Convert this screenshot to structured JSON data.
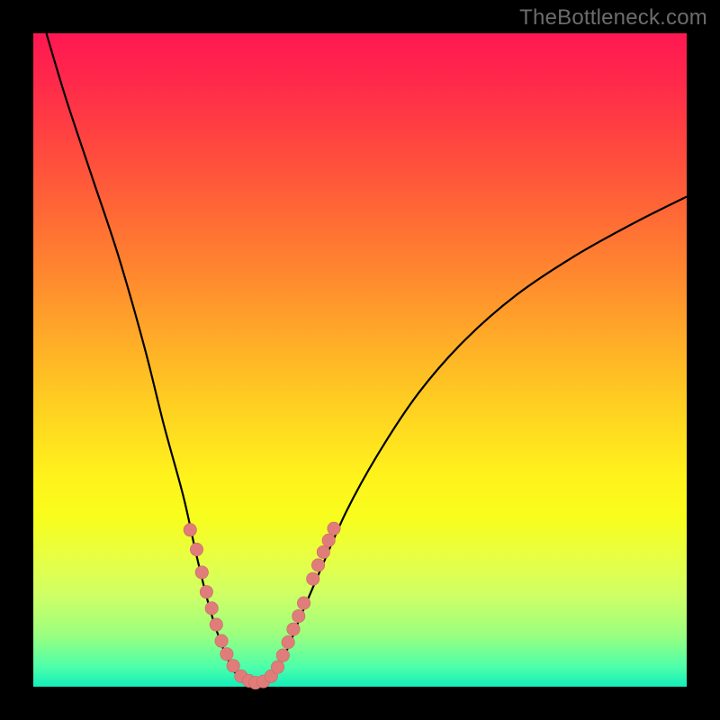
{
  "watermark": "TheBottleneck.com",
  "chart_data": {
    "type": "line",
    "title": "",
    "xlabel": "",
    "ylabel": "",
    "xlim": [
      0,
      100
    ],
    "ylim": [
      0,
      100
    ],
    "curve": {
      "name": "bottleneck-curve",
      "points": [
        {
          "x": 2,
          "y": 100
        },
        {
          "x": 5,
          "y": 90
        },
        {
          "x": 9,
          "y": 78
        },
        {
          "x": 13,
          "y": 66
        },
        {
          "x": 17,
          "y": 52
        },
        {
          "x": 20,
          "y": 40
        },
        {
          "x": 23,
          "y": 29
        },
        {
          "x": 25,
          "y": 20
        },
        {
          "x": 27,
          "y": 12
        },
        {
          "x": 29,
          "y": 6
        },
        {
          "x": 31,
          "y": 2
        },
        {
          "x": 33,
          "y": 0.3
        },
        {
          "x": 35,
          "y": 0.3
        },
        {
          "x": 37,
          "y": 2
        },
        {
          "x": 39,
          "y": 6
        },
        {
          "x": 41,
          "y": 11
        },
        {
          "x": 44,
          "y": 18
        },
        {
          "x": 48,
          "y": 27
        },
        {
          "x": 53,
          "y": 36
        },
        {
          "x": 59,
          "y": 45
        },
        {
          "x": 66,
          "y": 53
        },
        {
          "x": 74,
          "y": 60
        },
        {
          "x": 83,
          "y": 66
        },
        {
          "x": 92,
          "y": 71
        },
        {
          "x": 100,
          "y": 75
        }
      ]
    },
    "dots_left": [
      {
        "x": 24.0,
        "y": 24.0
      },
      {
        "x": 25.0,
        "y": 21.0
      },
      {
        "x": 25.8,
        "y": 17.5
      },
      {
        "x": 26.5,
        "y": 14.5
      },
      {
        "x": 27.3,
        "y": 12.0
      },
      {
        "x": 28.0,
        "y": 9.5
      },
      {
        "x": 28.8,
        "y": 7.0
      },
      {
        "x": 29.6,
        "y": 5.0
      },
      {
        "x": 30.6,
        "y": 3.2
      },
      {
        "x": 31.8,
        "y": 1.6
      },
      {
        "x": 33.0,
        "y": 0.9
      }
    ],
    "dots_bottom": [
      {
        "x": 34.0,
        "y": 0.6
      },
      {
        "x": 35.2,
        "y": 0.8
      }
    ],
    "dots_right": [
      {
        "x": 36.4,
        "y": 1.6
      },
      {
        "x": 37.4,
        "y": 3.0
      },
      {
        "x": 38.2,
        "y": 4.8
      },
      {
        "x": 39.0,
        "y": 6.8
      },
      {
        "x": 39.8,
        "y": 8.8
      },
      {
        "x": 40.6,
        "y": 10.8
      },
      {
        "x": 41.4,
        "y": 12.8
      },
      {
        "x": 42.8,
        "y": 16.5
      },
      {
        "x": 43.6,
        "y": 18.6
      },
      {
        "x": 44.4,
        "y": 20.6
      },
      {
        "x": 45.2,
        "y": 22.4
      },
      {
        "x": 46.0,
        "y": 24.2
      }
    ]
  }
}
